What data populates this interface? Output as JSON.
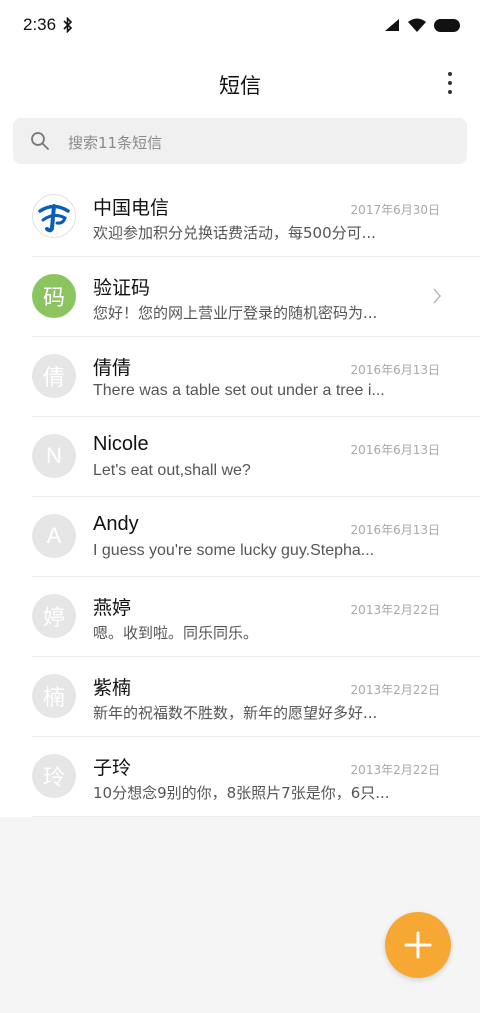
{
  "status_bar": {
    "time": "2:36"
  },
  "header": {
    "title": "短信"
  },
  "search": {
    "placeholder": "搜索11条短信"
  },
  "conversations": [
    {
      "name": "中国电信",
      "snippet": "欢迎参加积分兑换话费活动，每500分可...",
      "date": "2017年6月30日",
      "avatar": "china-telecom-logo"
    },
    {
      "name": "验证码",
      "snippet": "您好！您的网上营业厅登录的随机密码为...",
      "date": "",
      "avatar_text": "码",
      "avatar_color": "#8cc560"
    },
    {
      "name": "倩倩",
      "snippet": "There was a table set out under a tree i...",
      "date": "2016年6月13日",
      "avatar_text": "倩"
    },
    {
      "name": "Nicole",
      "snippet": "Let's eat out,shall we?",
      "date": "2016年6月13日",
      "avatar_text": "N"
    },
    {
      "name": "Andy",
      "snippet": "I guess you're some lucky guy.Stepha...",
      "date": "2016年6月13日",
      "avatar_text": "A"
    },
    {
      "name": "燕婷",
      "snippet": "嗯。收到啦。同乐同乐。",
      "date": "2013年2月22日",
      "avatar_text": "婷"
    },
    {
      "name": "紫楠",
      "snippet": "新年的祝福数不胜数，新年的愿望好多好...",
      "date": "2013年2月22日",
      "avatar_text": "楠"
    },
    {
      "name": "子玲",
      "snippet": "10分想念9别的你，8张照片7张是你，6只...",
      "date": "2013年2月22日",
      "avatar_text": "玲"
    }
  ],
  "colors": {
    "fab": "#f7a733",
    "verify_avatar": "#8cc560",
    "telecom_blue": "#0a5fb4"
  }
}
